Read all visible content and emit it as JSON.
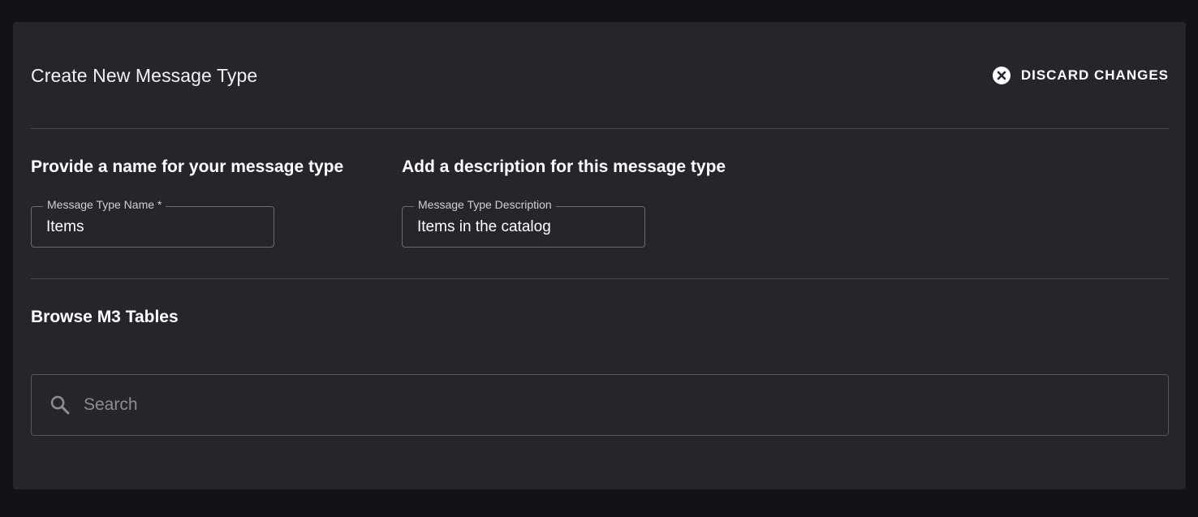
{
  "header": {
    "title": "Create New Message Type",
    "discard_label": "DISCARD CHANGES"
  },
  "name_section": {
    "heading": "Provide a name for your message type",
    "field_label": "Message Type Name *",
    "field_value": "Items"
  },
  "description_section": {
    "heading": "Add a description for this message type",
    "field_label": "Message Type Description",
    "field_value": "Items in the catalog"
  },
  "browse_section": {
    "heading": "Browse M3 Tables",
    "search_placeholder": "Search"
  },
  "icons": {
    "discard": "close-circle-icon",
    "search": "search-icon"
  },
  "colors": {
    "background": "#121318",
    "panel": "#25262b",
    "text": "#ffffff",
    "muted_text": "#8c8d91",
    "border": "#6a6b70"
  }
}
